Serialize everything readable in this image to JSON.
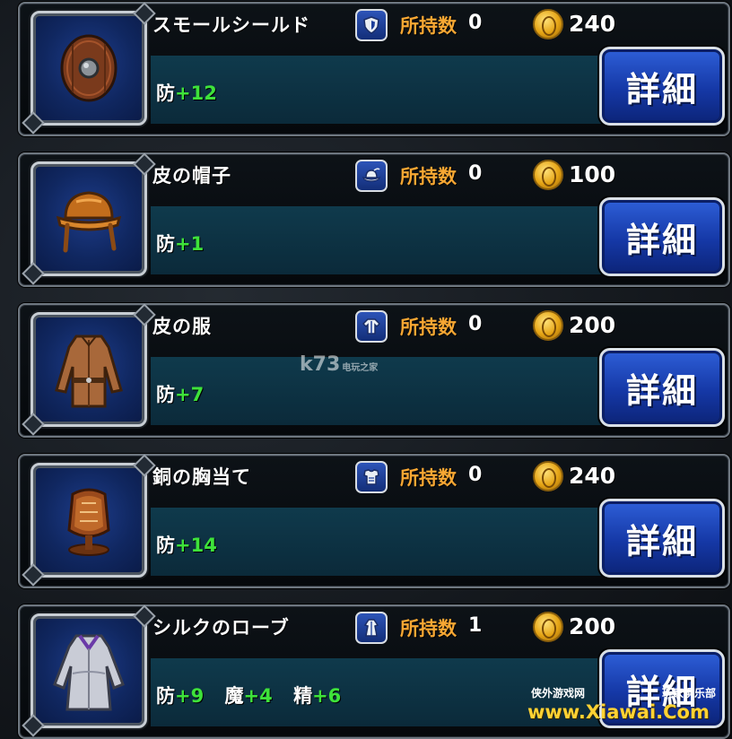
{
  "labels": {
    "owned": "所持数",
    "detail": "詳細"
  },
  "items": [
    {
      "name": "スモールシールド",
      "type_icon": "shield-icon",
      "owned": "0",
      "price": "240",
      "stats": [
        {
          "label": "防",
          "value": "+12"
        }
      ]
    },
    {
      "name": "皮の帽子",
      "type_icon": "hat-icon",
      "owned": "0",
      "price": "100",
      "stats": [
        {
          "label": "防",
          "value": "+1"
        }
      ]
    },
    {
      "name": "皮の服",
      "type_icon": "clothes-icon",
      "owned": "0",
      "price": "200",
      "stats": [
        {
          "label": "防",
          "value": "+7"
        }
      ]
    },
    {
      "name": "銅の胸当て",
      "type_icon": "armor-icon",
      "owned": "0",
      "price": "240",
      "stats": [
        {
          "label": "防",
          "value": "+14"
        }
      ]
    },
    {
      "name": "シルクのローブ",
      "type_icon": "robe-icon",
      "owned": "1",
      "price": "200",
      "stats": [
        {
          "label": "防",
          "value": "+9"
        },
        {
          "label": "魔",
          "value": "+4"
        },
        {
          "label": "精",
          "value": "+6"
        }
      ]
    }
  ],
  "watermarks": {
    "center": {
      "text": "k73",
      "small": "电玩之家"
    },
    "corner": {
      "top_left": "侠外游戏网",
      "top_right": "玩家俱乐部",
      "domain": "www.Xiawai.Com"
    }
  },
  "colors": {
    "owned_label": "#f7a733",
    "stat_value": "#3ee23a",
    "button": "#1538a6"
  }
}
